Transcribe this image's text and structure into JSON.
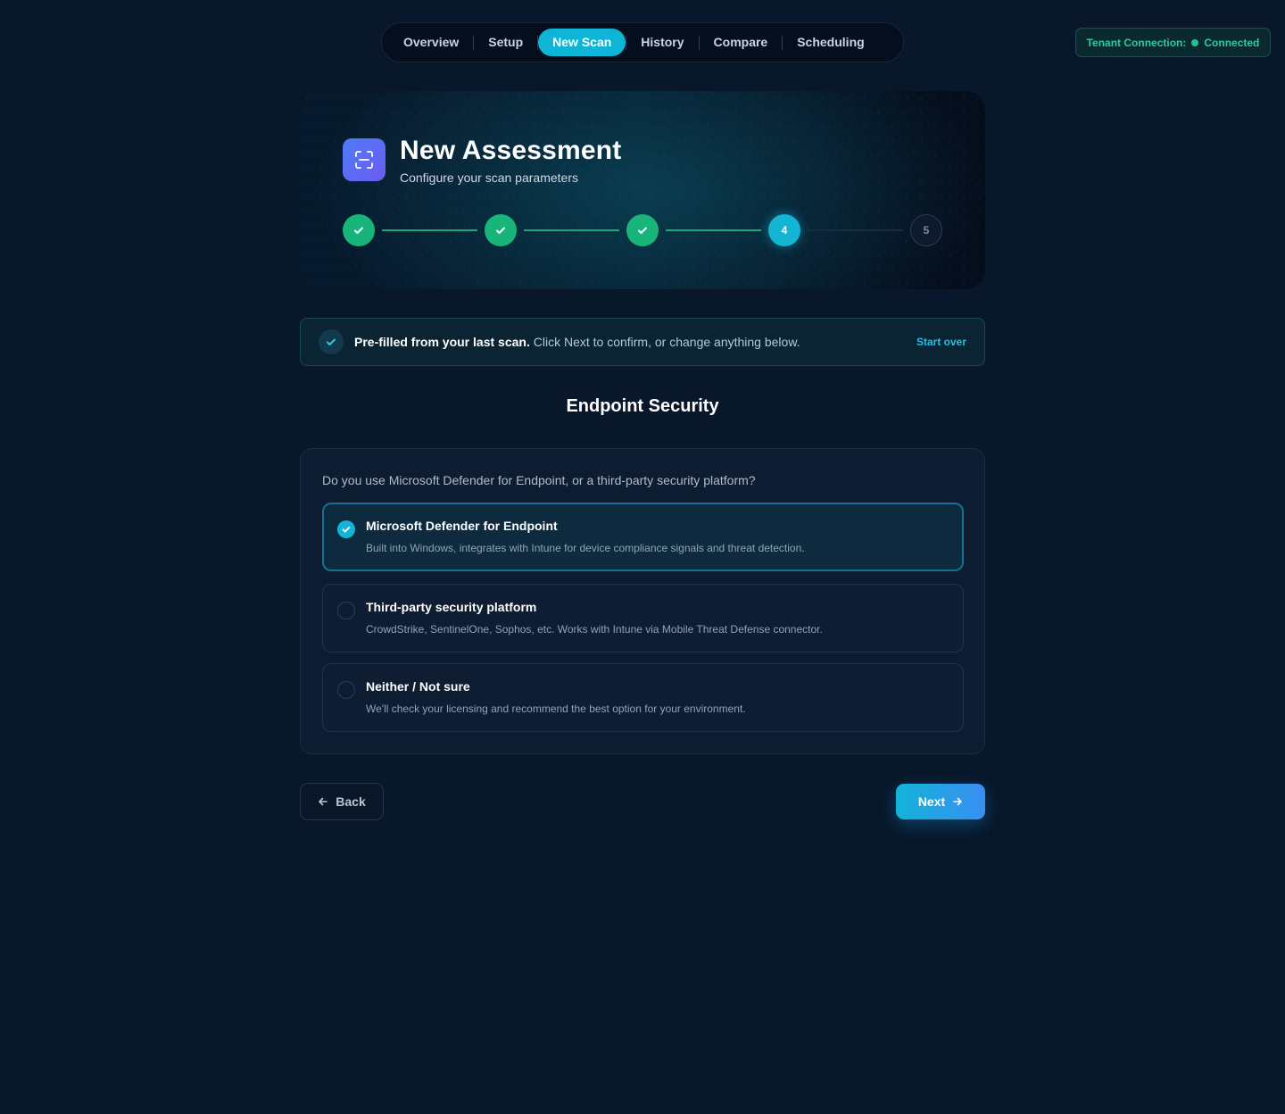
{
  "nav": {
    "tabs": [
      {
        "label": "Overview",
        "active": false
      },
      {
        "label": "Setup",
        "active": false
      },
      {
        "label": "New Scan",
        "active": true
      },
      {
        "label": "History",
        "active": false
      },
      {
        "label": "Compare",
        "active": false
      },
      {
        "label": "Scheduling",
        "active": false
      }
    ]
  },
  "tenant": {
    "label": "Tenant Connection:",
    "status": "Connected",
    "status_color": "#22c38e"
  },
  "hero": {
    "icon": "scan-icon",
    "title": "New Assessment",
    "subtitle": "Configure your scan parameters"
  },
  "stepper": {
    "current": 4,
    "steps": [
      {
        "label": "1",
        "state": "done"
      },
      {
        "label": "2",
        "state": "done"
      },
      {
        "label": "3",
        "state": "done"
      },
      {
        "label": "4",
        "state": "current"
      },
      {
        "label": "5",
        "state": "todo"
      }
    ]
  },
  "banner": {
    "bold": "Pre-filled from your last scan.",
    "text": " Click Next to confirm, or change anything below.",
    "link": "Start over"
  },
  "section": {
    "title": "Endpoint Security",
    "question": "Do you use Microsoft Defender for Endpoint, or a third-party security platform?",
    "options": [
      {
        "title": "Microsoft Defender for Endpoint",
        "description": "Built into Windows, integrates with Intune for device compliance signals and threat detection.",
        "selected": true
      },
      {
        "title": "Third-party security platform",
        "description": "CrowdStrike, SentinelOne, Sophos, etc. Works with Intune via Mobile Threat Defense connector.",
        "selected": false
      },
      {
        "title": "Neither / Not sure",
        "description": "We'll check your licensing and recommend the best option for your environment.",
        "selected": false
      }
    ]
  },
  "footer": {
    "back_label": "Back",
    "next_label": "Next"
  },
  "colors": {
    "accent": "#13b4d4",
    "success": "#18b57a",
    "background": "#08172a"
  }
}
